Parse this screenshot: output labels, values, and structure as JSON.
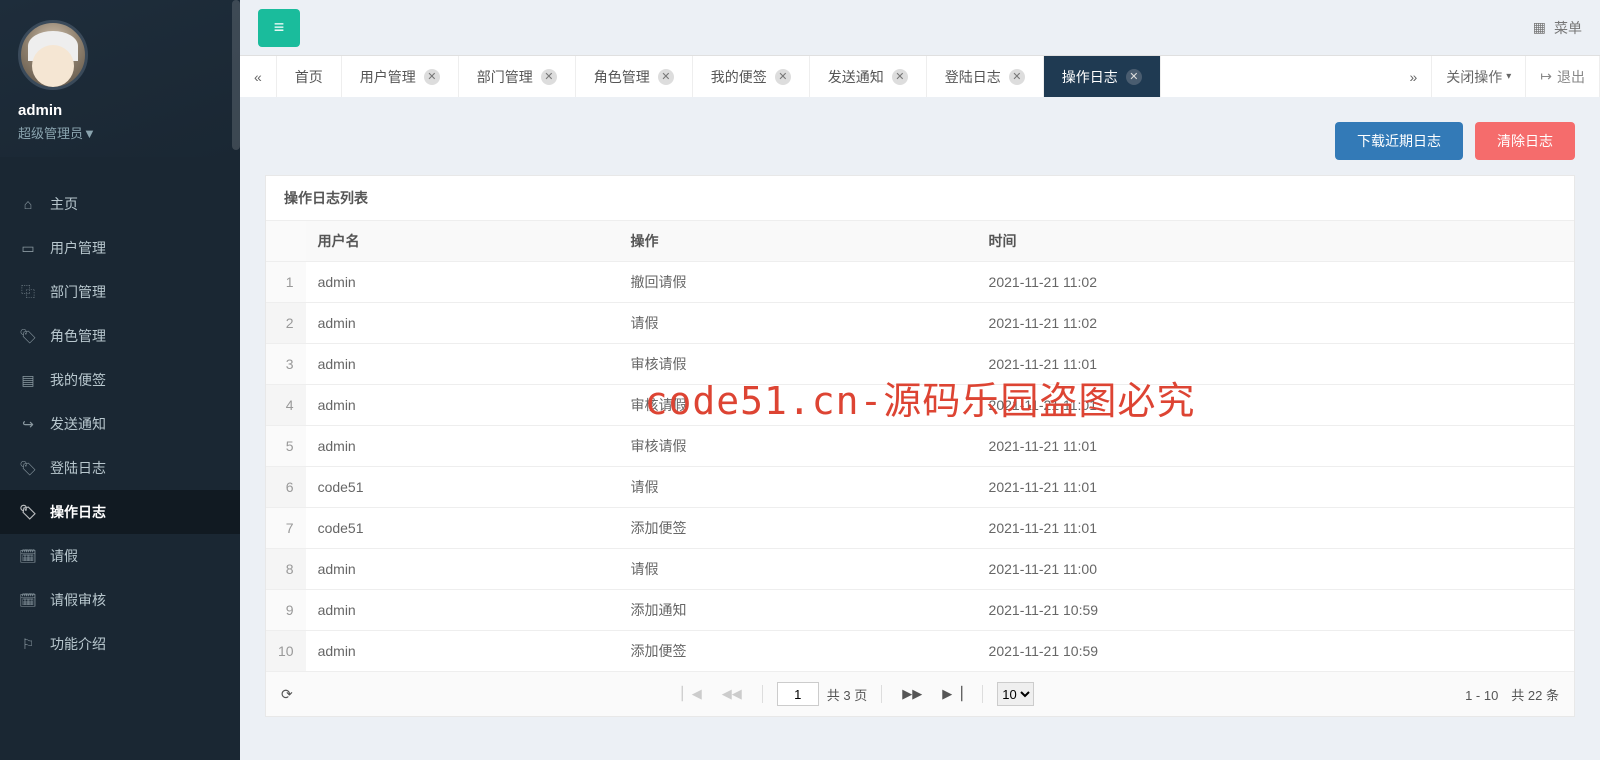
{
  "user": {
    "name": "admin",
    "role": "超级管理员▼"
  },
  "sidebar": {
    "items": [
      {
        "icon": "home-icon",
        "glyph": "⌂",
        "label": "主页"
      },
      {
        "icon": "users-icon",
        "glyph": "▭",
        "label": "用户管理"
      },
      {
        "icon": "dept-icon",
        "glyph": "⿻",
        "label": "部门管理"
      },
      {
        "icon": "role-icon",
        "glyph": "🏷",
        "label": "角色管理"
      },
      {
        "icon": "note-icon",
        "glyph": "▤",
        "label": "我的便签"
      },
      {
        "icon": "send-icon",
        "glyph": "↪",
        "label": "发送通知"
      },
      {
        "icon": "login-log-icon",
        "glyph": "🏷",
        "label": "登陆日志"
      },
      {
        "icon": "op-log-icon",
        "glyph": "🏷",
        "label": "操作日志"
      },
      {
        "icon": "leave-icon",
        "glyph": "🗓",
        "label": "请假"
      },
      {
        "icon": "review-icon",
        "glyph": "🗓",
        "label": "请假审核"
      },
      {
        "icon": "feature-icon",
        "glyph": "⚐",
        "label": "功能介绍"
      }
    ],
    "activeIndex": 7
  },
  "topbar": {
    "menuLabel": "菜单"
  },
  "tabs": {
    "items": [
      {
        "label": "首页",
        "closable": false
      },
      {
        "label": "用户管理",
        "closable": true
      },
      {
        "label": "部门管理",
        "closable": true
      },
      {
        "label": "角色管理",
        "closable": true
      },
      {
        "label": "我的便签",
        "closable": true
      },
      {
        "label": "发送通知",
        "closable": true
      },
      {
        "label": "登陆日志",
        "closable": true
      },
      {
        "label": "操作日志",
        "closable": true
      }
    ],
    "activeIndex": 7,
    "closeOpsLabel": "关闭操作",
    "exitLabel": "退出"
  },
  "actions": {
    "download": "下载近期日志",
    "clear": "清除日志"
  },
  "panel": {
    "title": "操作日志列表"
  },
  "table": {
    "headers": {
      "user": "用户名",
      "op": "操作",
      "time": "时间"
    },
    "rows": [
      {
        "idx": "1",
        "user": "admin",
        "op": "撤回请假",
        "time": "2021-11-21 11:02"
      },
      {
        "idx": "2",
        "user": "admin",
        "op": "请假",
        "time": "2021-11-21 11:02"
      },
      {
        "idx": "3",
        "user": "admin",
        "op": "审核请假",
        "time": "2021-11-21 11:01"
      },
      {
        "idx": "4",
        "user": "admin",
        "op": "审核请假",
        "time": "2021-11-21 11:01"
      },
      {
        "idx": "5",
        "user": "admin",
        "op": "审核请假",
        "time": "2021-11-21 11:01"
      },
      {
        "idx": "6",
        "user": "code51",
        "op": "请假",
        "time": "2021-11-21 11:01"
      },
      {
        "idx": "7",
        "user": "code51",
        "op": "添加便签",
        "time": "2021-11-21 11:01"
      },
      {
        "idx": "8",
        "user": "admin",
        "op": "请假",
        "time": "2021-11-21 11:00"
      },
      {
        "idx": "9",
        "user": "admin",
        "op": "添加通知",
        "time": "2021-11-21 10:59"
      },
      {
        "idx": "10",
        "user": "admin",
        "op": "添加便签",
        "time": "2021-11-21 10:59"
      }
    ]
  },
  "pager": {
    "page": "1",
    "totalPagesLabel": "共 3 页",
    "pageSize": "10",
    "summary": "1 - 10　共 22 条"
  },
  "watermark": "code51.cn-源码乐园盗图必究"
}
